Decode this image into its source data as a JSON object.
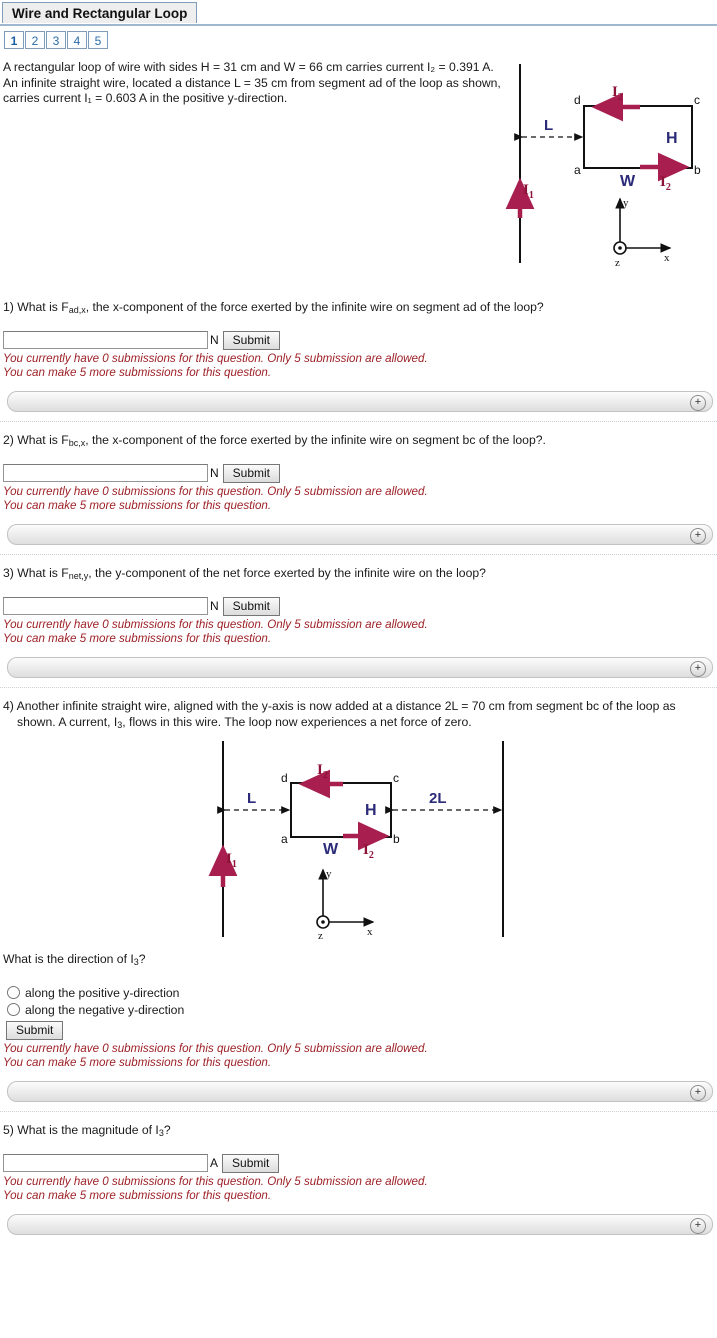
{
  "header": {
    "title": "Wire and Rectangular Loop",
    "tabs": [
      {
        "label": "1",
        "active": true
      },
      {
        "label": "2",
        "active": false
      },
      {
        "label": "3",
        "active": false
      },
      {
        "label": "4",
        "active": false
      },
      {
        "label": "5",
        "active": false
      }
    ]
  },
  "intro": {
    "text": "A rectangular loop of wire with sides H = 31 cm and W = 66 cm carries current I₂ = 0.391 A. An infinite straight wire, located a distance L = 35 cm from segment ad of the loop as shown, carries current I₁ = 0.603 A in the positive y-direction."
  },
  "figure1": {
    "labels": {
      "corner_a": "a",
      "corner_b": "b",
      "corner_c": "c",
      "corner_d": "d",
      "height": "H",
      "width": "W",
      "distance_L": "L",
      "current_top": "I",
      "current_top_sub": "2",
      "current_bottom": "I",
      "current_bottom_sub": "2",
      "current_wire": "I",
      "current_wire_sub": "1",
      "axis_x": "x",
      "axis_y": "y",
      "axis_z": "z"
    }
  },
  "figure2": {
    "labels": {
      "corner_a": "a",
      "corner_b": "b",
      "corner_c": "c",
      "corner_d": "d",
      "height": "H",
      "width": "W",
      "distance_L": "L",
      "distance_2L": "2L",
      "current_top": "I",
      "current_top_sub": "2",
      "current_bottom": "I",
      "current_bottom_sub": "2",
      "current_wire": "I",
      "current_wire_sub": "1",
      "axis_x": "x",
      "axis_y": "y",
      "axis_z": "z"
    }
  },
  "common": {
    "submit_label": "Submit",
    "unit_newton": "N",
    "unit_ampere": "A",
    "note_line1": "You currently have 0 submissions for this question. Only 5 submission are allowed.",
    "note_line2": "You can make 5 more submissions for this question.",
    "plus_glyph": "+",
    "input_value": "",
    "input_placeholder": ""
  },
  "questions": [
    {
      "number": "1)",
      "prompt_pre": "What is F",
      "prompt_sub": "ad,x",
      "prompt_post": ", the x-component of the force exerted by the infinite wire on segment ad of the loop?",
      "unit": "N"
    },
    {
      "number": "2)",
      "prompt_pre": "What is F",
      "prompt_sub": "bc,x",
      "prompt_post": ", the x-component of the force exerted by the infinite wire on segment bc of the loop?.",
      "unit": "N"
    },
    {
      "number": "3)",
      "prompt_pre": "What is F",
      "prompt_sub": "net,y",
      "prompt_post": ", the y-component of the net force exerted by the infinite wire on the loop?",
      "unit": "N"
    },
    {
      "number": "4)",
      "prompt_pre": "Another infinite straight wire, aligned with the y-axis is now added at a distance 2L = 70 cm from segment bc of the loop as shown. A current, I",
      "prompt_sub": "3",
      "prompt_post": ", flows in this wire. The loop now experiences a net force of zero.",
      "sub_question_pre": "What is the direction of I",
      "sub_question_sub": "3",
      "sub_question_post": "?",
      "options": [
        "along the positive y-direction",
        "along the negative y-direction"
      ]
    },
    {
      "number": "5)",
      "prompt_pre": "What is the magnitude of I",
      "prompt_sub": "3",
      "prompt_post": "?",
      "unit": "A"
    }
  ],
  "colors": {
    "accent_crimson": "#a81f4f",
    "label_navy": "#2b2b7a",
    "note_red": "#9d2026",
    "tab_blue": "#2c6ca8",
    "tab_border": "#7f9db9"
  }
}
